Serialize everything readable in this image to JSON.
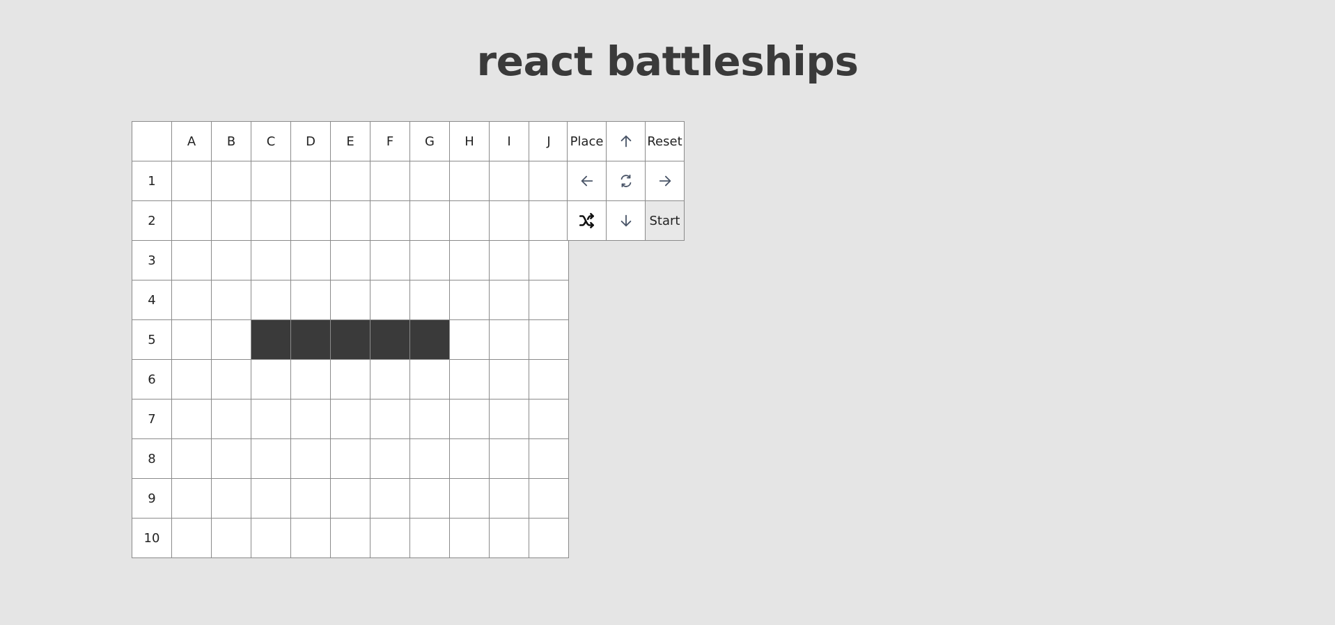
{
  "title": "react battleships",
  "board": {
    "columns": [
      "A",
      "B",
      "C",
      "D",
      "E",
      "F",
      "G",
      "H",
      "I",
      "J"
    ],
    "rows": [
      "1",
      "2",
      "3",
      "4",
      "5",
      "6",
      "7",
      "8",
      "9",
      "10"
    ],
    "ship_cells": [
      "C5",
      "D5",
      "E5",
      "F5",
      "G5"
    ],
    "colors": {
      "empty": "#ffffff",
      "ship": "#3a3a3a",
      "grid": "#8a8a8a"
    }
  },
  "controls": {
    "place_label": "Place",
    "reset_label": "Reset",
    "start_label": "Start",
    "up_icon": "arrow-up-icon",
    "left_icon": "arrow-left-icon",
    "rotate_icon": "rotate-icon",
    "right_icon": "arrow-right-icon",
    "random_icon": "shuffle-icon",
    "down_icon": "arrow-down-icon"
  }
}
